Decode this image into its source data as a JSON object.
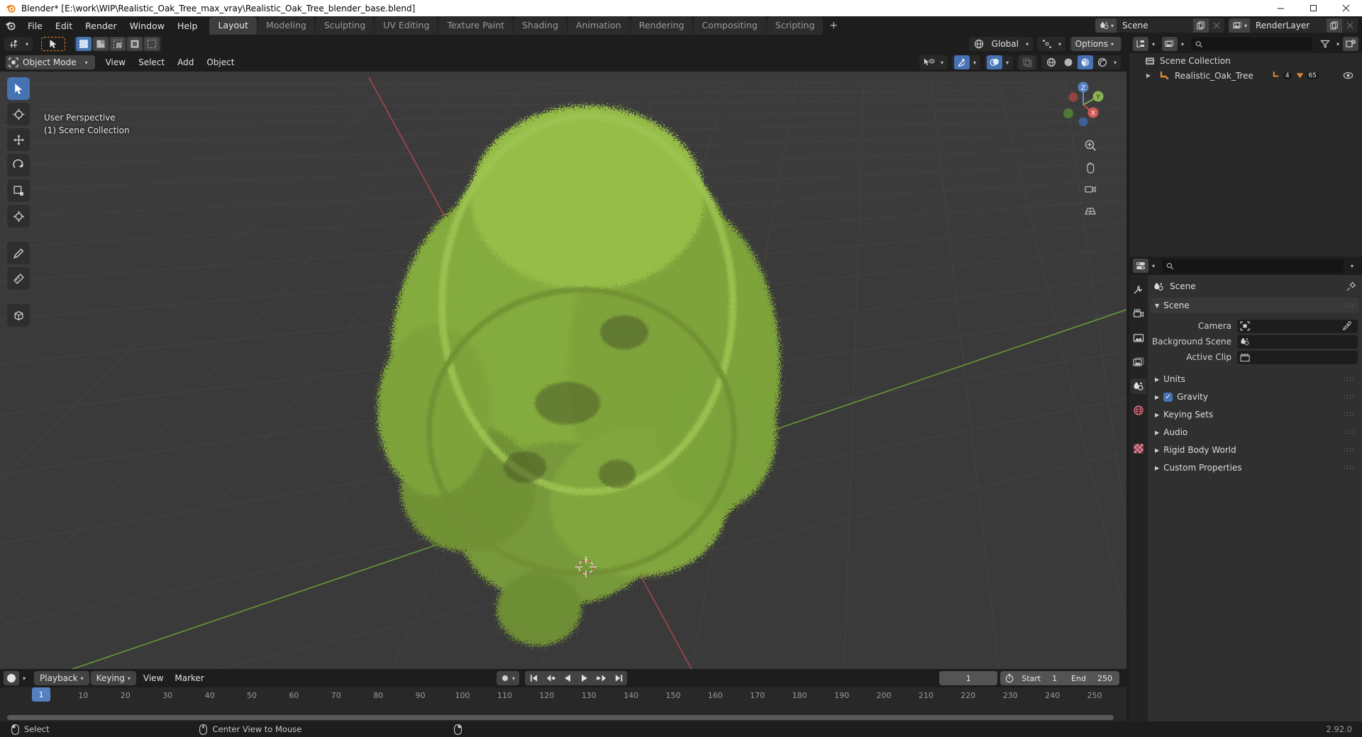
{
  "window": {
    "title": "Blender* [E:\\work\\WIP\\Realistic_Oak_Tree_max_vray\\Realistic_Oak_Tree_blender_base.blend]",
    "minimize": "—",
    "maximize": "❐",
    "close": "✕"
  },
  "topbar": {
    "menus": [
      "File",
      "Edit",
      "Render",
      "Window",
      "Help"
    ],
    "workspaces": [
      {
        "label": "Layout",
        "active": true
      },
      {
        "label": "Modeling",
        "active": false
      },
      {
        "label": "Sculpting",
        "active": false
      },
      {
        "label": "UV Editing",
        "active": false
      },
      {
        "label": "Texture Paint",
        "active": false
      },
      {
        "label": "Shading",
        "active": false
      },
      {
        "label": "Animation",
        "active": false
      },
      {
        "label": "Rendering",
        "active": false
      },
      {
        "label": "Compositing",
        "active": false
      },
      {
        "label": "Scripting",
        "active": false
      }
    ],
    "add_workspace": "+",
    "scene_name": "Scene",
    "viewlayer_name": "RenderLayer"
  },
  "viewport": {
    "mode": "Object Mode",
    "menus": [
      "View",
      "Select",
      "Add",
      "Object"
    ],
    "transform_orientation": "Global",
    "options_label": "Options",
    "overlay_line1": "User Perspective",
    "overlay_line2": "(1) Scene Collection",
    "gizmo_axes": {
      "z": "Z",
      "y": "Y",
      "x": "X"
    }
  },
  "outliner": {
    "search_placeholder": "",
    "rows": [
      {
        "label": "Scene Collection",
        "indent": 0,
        "icon": "collection-icon"
      },
      {
        "label": "Realistic_Oak_Tree",
        "indent": 1,
        "icon": "armature-icon",
        "badge_modifier": "4",
        "badge_mesh": "65"
      }
    ]
  },
  "properties": {
    "search_placeholder": "",
    "breadcrumb": "Scene",
    "panel_title": "Scene",
    "rows": [
      {
        "label": "Camera",
        "value": "",
        "icon": "camera-data-icon",
        "eyedropper": true
      },
      {
        "label": "Background Scene",
        "value": "",
        "icon": "scene-icon",
        "eyedropper": false
      },
      {
        "label": "Active Clip",
        "value": "",
        "icon": "clip-icon",
        "eyedropper": false
      }
    ],
    "collapsed_panels": [
      {
        "label": "Units",
        "checkbox": false
      },
      {
        "label": "Gravity",
        "checkbox": true
      },
      {
        "label": "Keying Sets",
        "checkbox": false
      },
      {
        "label": "Audio",
        "checkbox": false
      },
      {
        "label": "Rigid Body World",
        "checkbox": false
      },
      {
        "label": "Custom Properties",
        "checkbox": false
      }
    ]
  },
  "timeline": {
    "editor_menu": "",
    "playback": "Playback",
    "keying": "Keying",
    "view": "View",
    "marker": "Marker",
    "current_frame": "1",
    "start_label": "Start",
    "start_value": "1",
    "end_label": "End",
    "end_value": "250",
    "ruler_ticks": [
      "10",
      "20",
      "30",
      "40",
      "50",
      "60",
      "70",
      "80",
      "90",
      "100",
      "110",
      "120",
      "130",
      "140",
      "150",
      "160",
      "170",
      "180",
      "190",
      "200",
      "210",
      "220",
      "230",
      "240",
      "250"
    ],
    "playhead_frame": "1"
  },
  "statusbar": {
    "left_action": "Select",
    "middle_action": "Center View to Mouse",
    "version": "2.92.0"
  },
  "colors": {
    "accent_blue": "#4772b3",
    "playhead_blue": "#5680c2",
    "orange": "#e08a34",
    "axis_x_red": "#b34a4a",
    "axis_y_green": "#7fb34a",
    "viewport_bg": "#393939"
  }
}
